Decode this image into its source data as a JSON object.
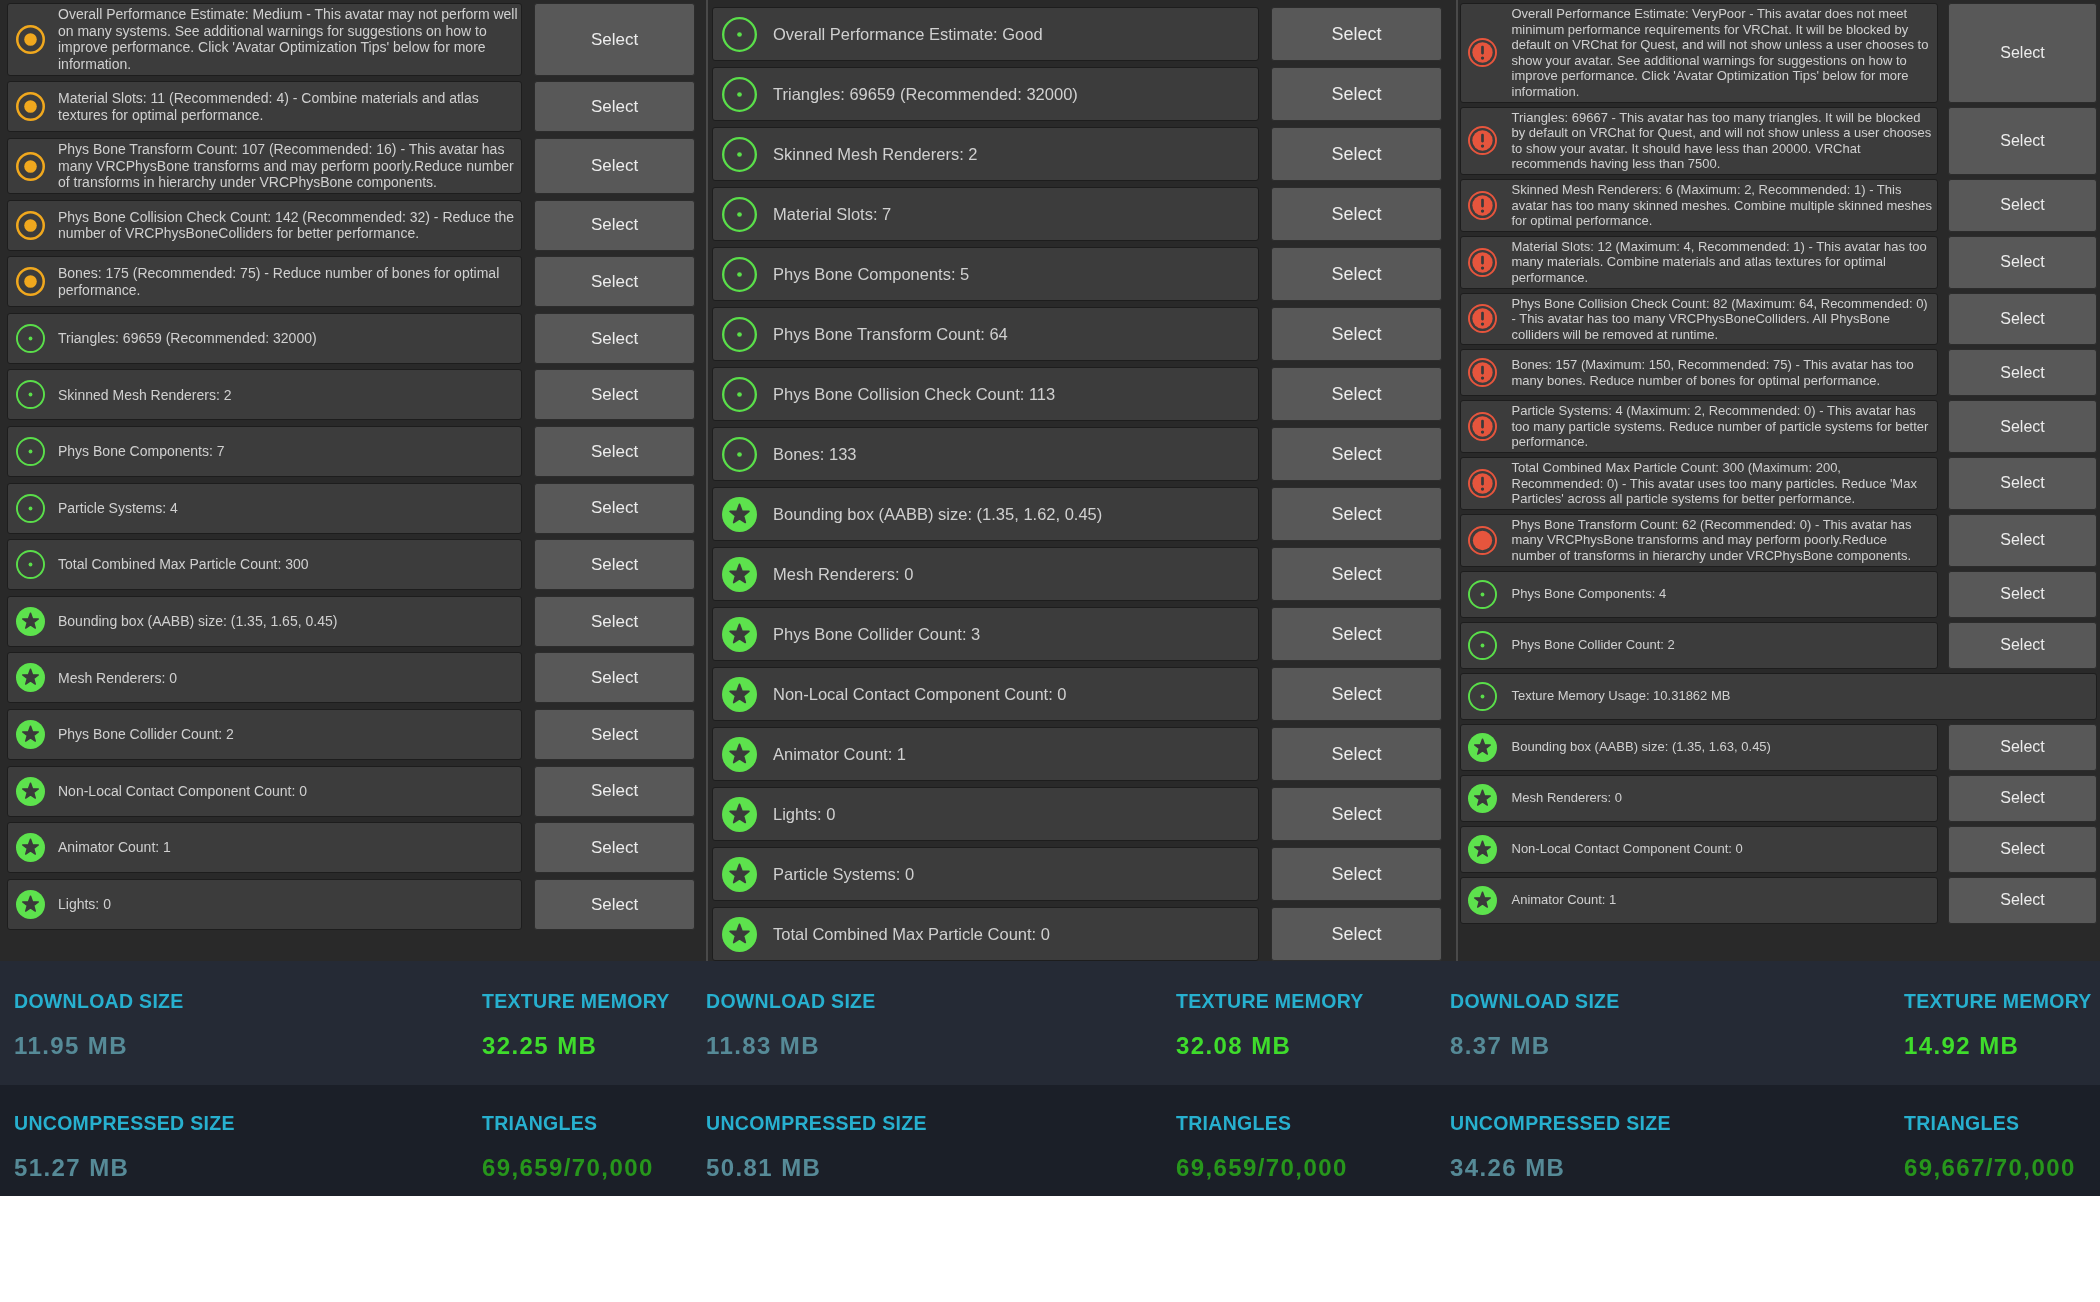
{
  "panels": [
    {
      "rows": [
        {
          "kind": "medium",
          "text": "Overall Performance Estimate: Medium - This avatar may not perform well on many systems. See additional warnings for suggestions on how to improve performance. Click 'Avatar Optimization Tips' below for more information.",
          "button": "Select"
        },
        {
          "kind": "medium",
          "text": "Material Slots: 11 (Recommended: 4) - Combine materials and atlas textures for optimal performance.",
          "button": "Select"
        },
        {
          "kind": "medium",
          "text": "Phys Bone Transform Count: 107 (Recommended: 16) - This avatar has many VRCPhysBone transforms and may perform poorly.Reduce number of transforms in hierarchy under VRCPhysBone components.",
          "button": "Select"
        },
        {
          "kind": "medium",
          "text": "Phys Bone Collision Check Count: 142 (Recommended: 32) - Reduce the number of VRCPhysBoneColliders for better performance.",
          "button": "Select"
        },
        {
          "kind": "medium",
          "text": "Bones: 175 (Recommended: 75) - Reduce number of bones for optimal performance.",
          "button": "Select"
        },
        {
          "kind": "good",
          "text": "Triangles: 69659 (Recommended: 32000)",
          "button": "Select"
        },
        {
          "kind": "good",
          "text": "Skinned Mesh Renderers: 2",
          "button": "Select"
        },
        {
          "kind": "good",
          "text": "Phys Bone Components: 7",
          "button": "Select"
        },
        {
          "kind": "good",
          "text": "Particle Systems: 4",
          "button": "Select"
        },
        {
          "kind": "good",
          "text": "Total Combined Max Particle Count: 300",
          "button": "Select"
        },
        {
          "kind": "excellent",
          "text": "Bounding box (AABB) size: (1.35, 1.65, 0.45)",
          "button": "Select"
        },
        {
          "kind": "excellent",
          "text": "Mesh Renderers: 0",
          "button": "Select"
        },
        {
          "kind": "excellent",
          "text": "Phys Bone Collider Count: 2",
          "button": "Select"
        },
        {
          "kind": "excellent",
          "text": "Non-Local Contact Component Count: 0",
          "button": "Select"
        },
        {
          "kind": "excellent",
          "text": "Animator Count: 1",
          "button": "Select"
        },
        {
          "kind": "excellent",
          "text": "Lights: 0",
          "button": "Select"
        }
      ],
      "stats": [
        {
          "label": "DOWNLOAD SIZE",
          "value": "11.95 MB",
          "color": "#568a97"
        },
        {
          "label": "TEXTURE MEMORY",
          "value": "32.25 MB",
          "color": "#3fdc2c"
        },
        {
          "label": "UNCOMPRESSED SIZE",
          "value": "51.27 MB",
          "color": "#568a97"
        },
        {
          "label": "TRIANGLES",
          "value": "69,659/70,000",
          "color": "#27961c"
        }
      ]
    },
    {
      "rows": [
        {
          "kind": "good",
          "text": "Overall Performance Estimate: Good",
          "button": "Select"
        },
        {
          "kind": "good",
          "text": "Triangles: 69659 (Recommended: 32000)",
          "button": "Select"
        },
        {
          "kind": "good",
          "text": "Skinned Mesh Renderers: 2",
          "button": "Select"
        },
        {
          "kind": "good",
          "text": "Material Slots: 7",
          "button": "Select"
        },
        {
          "kind": "good",
          "text": "Phys Bone Components: 5",
          "button": "Select"
        },
        {
          "kind": "good",
          "text": "Phys Bone Transform Count: 64",
          "button": "Select"
        },
        {
          "kind": "good",
          "text": "Phys Bone Collision Check Count: 113",
          "button": "Select"
        },
        {
          "kind": "good",
          "text": "Bones: 133",
          "button": "Select"
        },
        {
          "kind": "excellent",
          "text": "Bounding box (AABB) size: (1.35, 1.62, 0.45)",
          "button": "Select"
        },
        {
          "kind": "excellent",
          "text": "Mesh Renderers: 0",
          "button": "Select"
        },
        {
          "kind": "excellent",
          "text": "Phys Bone Collider Count: 3",
          "button": "Select"
        },
        {
          "kind": "excellent",
          "text": "Non-Local Contact Component Count: 0",
          "button": "Select"
        },
        {
          "kind": "excellent",
          "text": "Animator Count: 1",
          "button": "Select"
        },
        {
          "kind": "excellent",
          "text": "Lights: 0",
          "button": "Select"
        },
        {
          "kind": "excellent",
          "text": "Particle Systems: 0",
          "button": "Select"
        },
        {
          "kind": "excellent",
          "text": "Total Combined Max Particle Count: 0",
          "button": "Select"
        }
      ],
      "stats": [
        {
          "label": "DOWNLOAD SIZE",
          "value": "11.83 MB",
          "color": "#568a97"
        },
        {
          "label": "TEXTURE MEMORY",
          "value": "32.08 MB",
          "color": "#3fdc2c"
        },
        {
          "label": "UNCOMPRESSED SIZE",
          "value": "50.81 MB",
          "color": "#568a97"
        },
        {
          "label": "TRIANGLES",
          "value": "69,659/70,000",
          "color": "#27961c"
        }
      ]
    },
    {
      "rows": [
        {
          "kind": "verypoor",
          "text": "Overall Performance Estimate: VeryPoor - This avatar does not meet minimum performance requirements for VRChat. It will be blocked by default on VRChat for Quest, and will not show unless a user chooses to show your avatar. See additional warnings for suggestions on how to improve performance. Click 'Avatar Optimization Tips' below for more information.",
          "button": "Select"
        },
        {
          "kind": "verypoor",
          "text": "Triangles: 69667 - This avatar has too many triangles. It will be blocked by default on VRChat for Quest, and will not show unless a user chooses to show your avatar. It should have less than 20000. VRChat recommends having less than 7500.",
          "button": "Select"
        },
        {
          "kind": "verypoor",
          "text": "Skinned Mesh Renderers: 6 (Maximum: 2, Recommended: 1) - This avatar has too many skinned meshes. Combine multiple skinned meshes for optimal performance.",
          "button": "Select"
        },
        {
          "kind": "verypoor",
          "text": "Material Slots: 12 (Maximum: 4, Recommended: 1) - This avatar has too many materials. Combine materials and atlas textures for optimal performance.",
          "button": "Select"
        },
        {
          "kind": "verypoor",
          "text": "Phys Bone Collision Check Count: 82 (Maximum: 64, Recommended: 0) - This avatar has too many VRCPhysBoneColliders. All PhysBone colliders will be removed at runtime.",
          "button": "Select"
        },
        {
          "kind": "verypoor",
          "text": "Bones: 157 (Maximum: 150, Recommended: 75) - This avatar has too many bones. Reduce number of bones for optimal performance.",
          "button": "Select"
        },
        {
          "kind": "verypoor",
          "text": "Particle Systems: 4 (Maximum: 2, Recommended: 0) - This avatar has too many particle systems. Reduce number of particle systems for better performance.",
          "button": "Select"
        },
        {
          "kind": "verypoor",
          "text": "Total Combined Max Particle Count: 300 (Maximum: 200, Recommended: 0) - This avatar uses too many particles. Reduce 'Max Particles' across all particle systems for better performance.",
          "button": "Select"
        },
        {
          "kind": "poor",
          "text": "Phys Bone Transform Count: 62 (Recommended: 0) - This avatar has many VRCPhysBone transforms and may perform poorly.Reduce number of transforms in hierarchy under VRCPhysBone components.",
          "button": "Select"
        },
        {
          "kind": "good",
          "text": "Phys Bone Components: 4",
          "button": "Select"
        },
        {
          "kind": "good",
          "text": "Phys Bone Collider Count: 2",
          "button": "Select"
        },
        {
          "kind": "good",
          "text": "Texture Memory Usage: 10.31862 MB"
        },
        {
          "kind": "excellent",
          "text": "Bounding box (AABB) size: (1.35, 1.63, 0.45)",
          "button": "Select"
        },
        {
          "kind": "excellent",
          "text": "Mesh Renderers: 0",
          "button": "Select"
        },
        {
          "kind": "excellent",
          "text": "Non-Local Contact Component Count: 0",
          "button": "Select"
        },
        {
          "kind": "excellent",
          "text": "Animator Count: 1",
          "button": "Select"
        }
      ],
      "stats": [
        {
          "label": "DOWNLOAD SIZE",
          "value": "8.37 MB",
          "color": "#568a97"
        },
        {
          "label": "TEXTURE MEMORY",
          "value": "14.92 MB",
          "color": "#3fdc2c"
        },
        {
          "label": "UNCOMPRESSED SIZE",
          "value": "34.26 MB",
          "color": "#568a97"
        },
        {
          "label": "TRIANGLES",
          "value": "69,667/70,000",
          "color": "#27961c"
        }
      ]
    }
  ]
}
